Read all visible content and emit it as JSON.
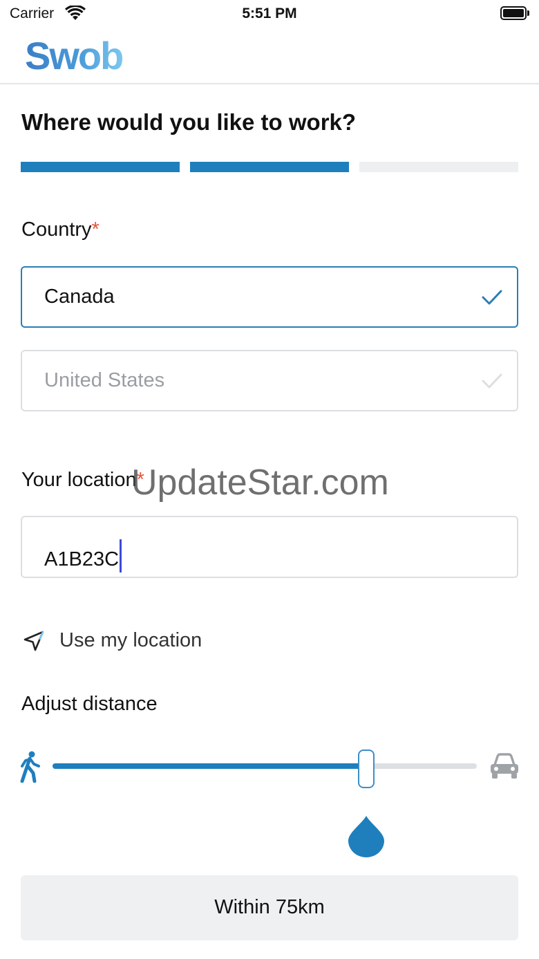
{
  "status_bar": {
    "carrier": "Carrier",
    "time": "5:51 PM"
  },
  "header": {
    "logo_text": "Swob"
  },
  "page": {
    "title": "Where would you like to work?"
  },
  "progress": {
    "total_steps": 3,
    "completed_steps": 2
  },
  "country": {
    "label": "Country",
    "required_marker": "*",
    "options": [
      {
        "label": "Canada",
        "selected": true
      },
      {
        "label": "United States",
        "selected": false
      }
    ]
  },
  "location": {
    "label": "Your location",
    "required_marker": "*",
    "value": "A1B23C",
    "use_my_location": "Use my location"
  },
  "distance": {
    "label": "Adjust distance",
    "slider_value_fraction": 0.74,
    "result_label": "Within 75km",
    "min_icon": "walking-person-icon",
    "max_icon": "car-icon"
  },
  "watermark": "UpdateStar.com",
  "colors": {
    "accent": "#1f7fbd",
    "required": "#e8533a",
    "inactive": "#eeeff0"
  }
}
